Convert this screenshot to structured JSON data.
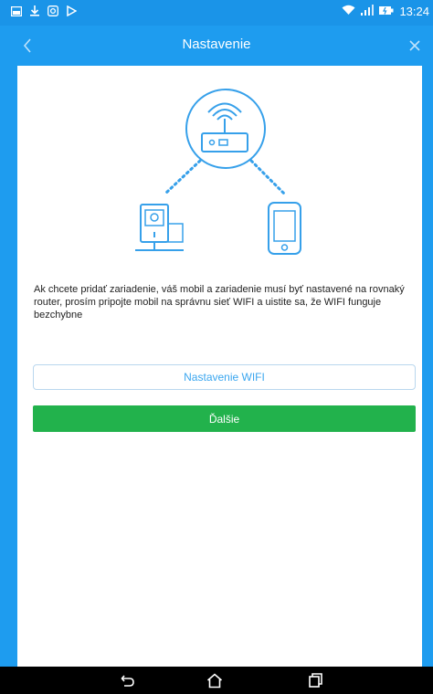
{
  "status_bar": {
    "time": "13:24",
    "left_icons": [
      "gallery-icon",
      "download-icon",
      "camera-icon",
      "play-icon"
    ],
    "right_icons": [
      "wifi-icon",
      "signal-icon",
      "battery-icon"
    ]
  },
  "header": {
    "title": "Nastavenie",
    "back_icon": "chevron-left-icon",
    "close_icon": "close-icon"
  },
  "content": {
    "description": "Ak chcete pridať zariadenie, váš mobil a zariadenie musí byť nastavené na rovnaký router, prosím pripojte mobil na správnu sieť WIFI a uistite sa, že WIFI funguje bezchybne",
    "wifi_button_label": "Nastavenie WIFI",
    "next_button_label": "Ďalšie"
  },
  "nav_bar": {
    "icons": [
      "back-icon",
      "home-icon",
      "recents-icon"
    ]
  },
  "colors": {
    "primary": "#1e9cef",
    "status_bar": "#1a94e8",
    "next_button": "#22b24c",
    "wifi_button_text": "#3aa6ef"
  }
}
